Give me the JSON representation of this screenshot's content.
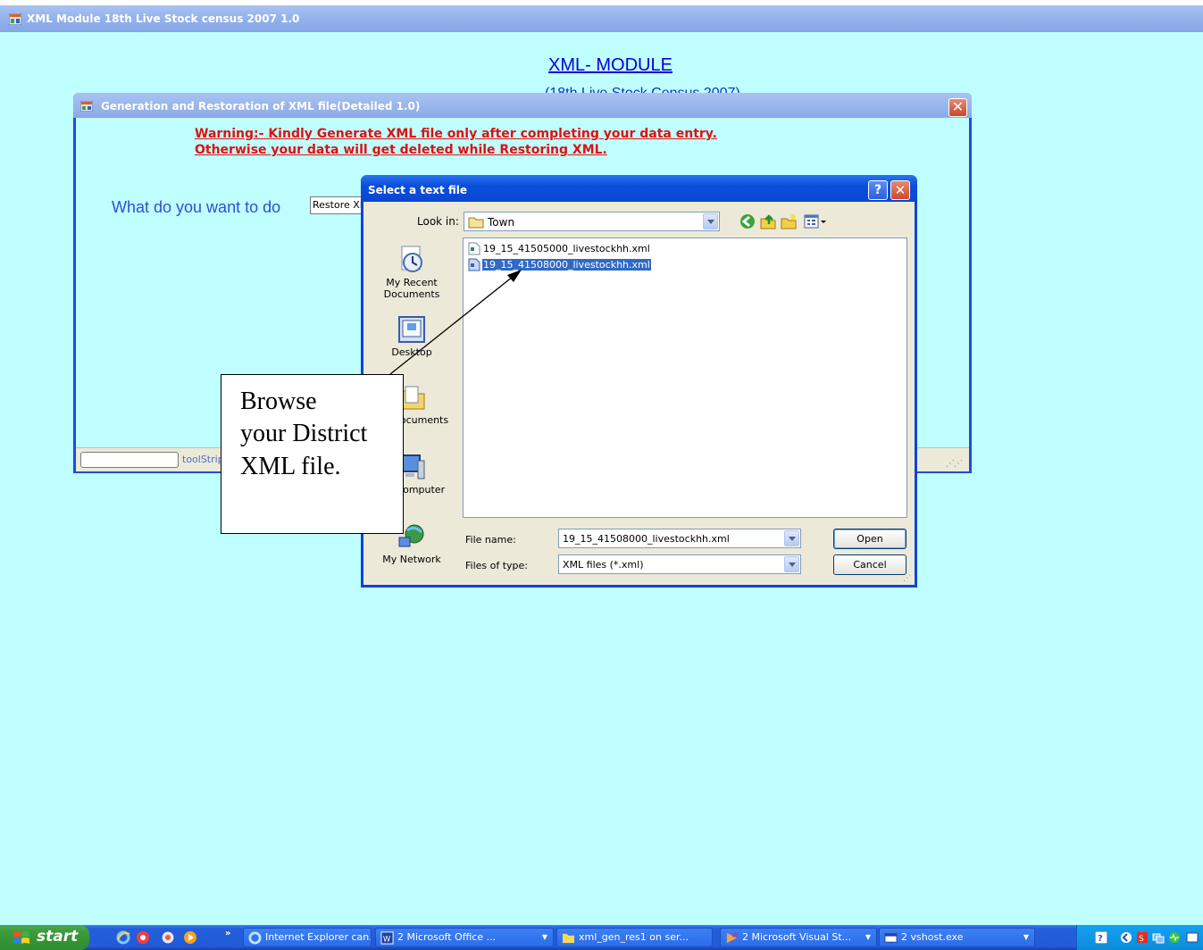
{
  "main_window": {
    "title": "XML Module 18th Live Stock census 2007 1.0",
    "heading": "XML- MODULE",
    "subheading": "(18th Live Stock Census 2007)"
  },
  "gen_window": {
    "title": "Generation and Restoration of XML file(Detailed 1.0)",
    "close_glyph": "✕",
    "warning_line1": "Warning:- Kindly Generate XML file only after completing your data entry.",
    "warning_line2": "Otherwise your data will get deleted while Restoring XML.",
    "question": "What do you want to do",
    "combo_value": "Restore XML",
    "status_label": "toolStrip"
  },
  "file_dialog": {
    "title": "Select a text file",
    "help_glyph": "?",
    "close_glyph": "✕",
    "look_in_label": "Look in:",
    "look_in_value": "Town",
    "places": [
      {
        "label_line1": "My Recent",
        "label_line2": "Documents",
        "icon": "recent-documents-icon"
      },
      {
        "label_line1": "Desktop",
        "label_line2": "",
        "icon": "desktop-icon"
      },
      {
        "label_line1": "My Documents",
        "label_line2": "",
        "icon": "my-documents-icon"
      },
      {
        "label_line1": "My Computer",
        "label_line2": "",
        "icon": "my-computer-icon"
      },
      {
        "label_line1": "My Network",
        "label_line2": "",
        "icon": "my-network-icon"
      }
    ],
    "files": [
      {
        "name": "19_15_41505000_livestockhh.xml",
        "selected": false
      },
      {
        "name": "19_15_41508000_livestockhh.xml",
        "selected": true
      }
    ],
    "file_name_label": "File name:",
    "file_name_value": "19_15_41508000_livestockhh.xml",
    "file_type_label": "Files of type:",
    "file_type_value": "XML files (*.xml)",
    "open_label": "Open",
    "cancel_label": "Cancel"
  },
  "callout": {
    "line1": "Browse",
    "line2": "your District",
    "line3": "XML file."
  },
  "taskbar": {
    "start_label": "start",
    "quick_launch_chevron": "»",
    "tasks": [
      {
        "label": "Internet Explorer can...",
        "icon": "ie-icon"
      },
      {
        "label": "2 Microsoft Office ...",
        "icon": "office-icon"
      },
      {
        "label": "xml_gen_res1 on ser...",
        "icon": "folder-icon"
      },
      {
        "label": "2 Microsoft Visual St...",
        "icon": "visual-studio-icon"
      },
      {
        "label": "2 vshost.exe",
        "icon": "window-icon"
      }
    ]
  }
}
